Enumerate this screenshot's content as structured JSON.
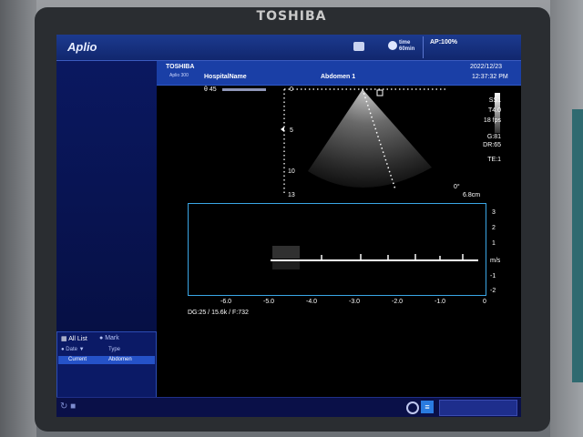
{
  "device": {
    "brand": "TOSHIBA"
  },
  "topbar": {
    "app_title": "Aplio",
    "ttm_label": "time\n60min",
    "ap_label": "AP:100%"
  },
  "header": {
    "logo": "TOSHIBA",
    "model": "Aplio 300",
    "hospital": "HospitalName",
    "exam": "Abdomen 1",
    "date": "2022/12/23",
    "time": "12:37:32 PM"
  },
  "image": {
    "angle": "θ 45",
    "depth_marks": [
      "0",
      "5",
      "10",
      "13"
    ],
    "angle_correction": "0°",
    "sample_depth": "6.8cm"
  },
  "params": {
    "probe": "SS1",
    "freq": "T4.0",
    "fps": "18 fps",
    "gain": "G:81",
    "dr": "DR:65",
    "te": "TE:1"
  },
  "doppler": {
    "y_ticks": [
      "3",
      "2",
      "1",
      "m/s",
      "-1",
      "-2"
    ],
    "x_ticks": [
      "-6.0",
      "-5.0",
      "-4.0",
      "-3.0",
      "-2.0",
      "-1.0",
      "0"
    ],
    "info": "DG:25 / 15.6k / F:732"
  },
  "list_panel": {
    "title": "All List",
    "mark_label": "Mark",
    "columns": [
      "Date",
      "Type"
    ],
    "rows": [
      {
        "date": "Current",
        "type": "Abdomen"
      }
    ]
  }
}
